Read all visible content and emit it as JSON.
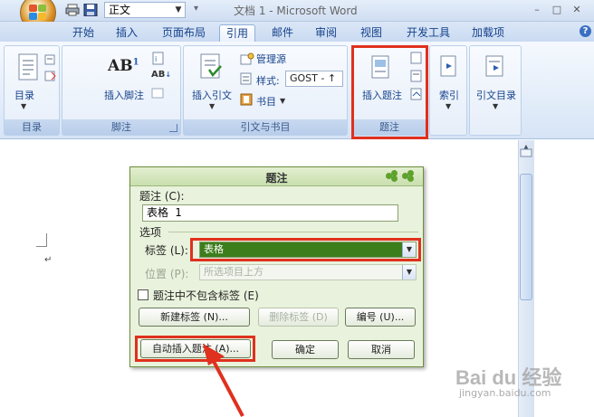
{
  "titlebar": {
    "style_box_value": "正文",
    "window_title": "文档 1 - Microsoft Word",
    "controls": [
      "–",
      "□",
      "✕"
    ]
  },
  "tabs": [
    {
      "label": "开始"
    },
    {
      "label": "插入"
    },
    {
      "label": "页面布局"
    },
    {
      "label": "引用"
    },
    {
      "label": "邮件"
    },
    {
      "label": "审阅"
    },
    {
      "label": "视图"
    },
    {
      "label": "开发工具"
    },
    {
      "label": "加载项"
    }
  ],
  "help_label": "?",
  "ribbon": {
    "toc": {
      "button_label": "目录",
      "group_label": "目录"
    },
    "footnotes": {
      "big_icon_text": "AB",
      "big_icon_sup": "1",
      "small_icon_text": "AB",
      "button_label": "插入脚注",
      "group_label": "脚注"
    },
    "citations": {
      "insert_citation_label": "插入引文",
      "manage_sources_label": "管理源",
      "style_label": "样式:",
      "style_value": "GOST - ↑",
      "bibliography_label": "书目",
      "group_label": "引文与书目"
    },
    "captions": {
      "button_label": "插入题注",
      "group_label": "题注"
    },
    "index": {
      "button_label": "索引"
    },
    "toa": {
      "button_label": "引文目录"
    }
  },
  "dialog": {
    "title": "题注",
    "caption_label": "题注 (C):",
    "caption_value": "表格 1",
    "options_label": "选项",
    "label_label": "标签 (L):",
    "label_value": "表格",
    "position_label": "位置 (P):",
    "position_value": "所选项目上方",
    "exclude_label_text": "题注中不包含标签 (E)",
    "buttons": {
      "new_label": "新建标签 (N)...",
      "delete_label": "删除标签 (D)",
      "numbering": "编号 (U)...",
      "autocaption": "自动插入题注 (A)...",
      "ok": "确定",
      "cancel": "取消"
    }
  },
  "watermark": {
    "brand": "Bai du 经验",
    "url": "jingyan.baidu.com"
  },
  "colors": {
    "highlight_red": "#e0301e",
    "dialog_green": "#e9f2dc",
    "selected_green": "#3c7d1c",
    "ribbon_text": "#15428b"
  }
}
